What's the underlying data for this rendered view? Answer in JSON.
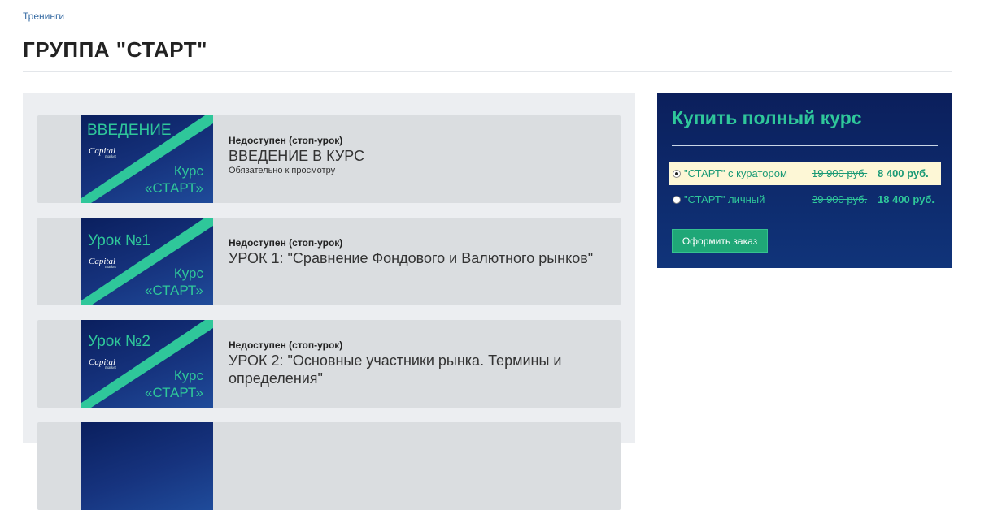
{
  "breadcrumb": "Тренинги",
  "page_title": "ГРУППА \"СТАРТ\"",
  "lessons": [
    {
      "thumb_title": "ВВЕДЕНИЕ",
      "status": "Недоступен (стоп-урок)",
      "title": "ВВЕДЕНИЕ В КУРС",
      "note": "Обязательно к просмотру"
    },
    {
      "thumb_title": "Урок №1",
      "status": "Недоступен (стоп-урок)",
      "title": "УРОК 1: \"Сравнение Фондового и Валютного рынков\"",
      "note": ""
    },
    {
      "thumb_title": "Урок №2",
      "status": "Недоступен (стоп-урок)",
      "title": "УРОК 2: \"Основные участники рынка. Термины и определения\"",
      "note": ""
    }
  ],
  "thumb": {
    "brand": "Capital",
    "brand_sub": "market",
    "kurs": "Курс",
    "start": "«СТАРТ»"
  },
  "buy": {
    "title": "Купить полный курс",
    "options": [
      {
        "label": "\"СТАРТ\" с куратором",
        "old_price": "19 900 руб.",
        "new_price": "8 400 руб.",
        "selected": true
      },
      {
        "label": "\"СТАРТ\" личный",
        "old_price": "29 900 руб.",
        "new_price": "18 400 руб.",
        "selected": false
      }
    ],
    "order_button": "Оформить заказ"
  },
  "colors": {
    "accent": "#2fc79a",
    "panel_dark": "#0b1f5c",
    "button": "#1fa777",
    "card_bg": "#dadde0",
    "panel_bg": "#eceef1"
  }
}
